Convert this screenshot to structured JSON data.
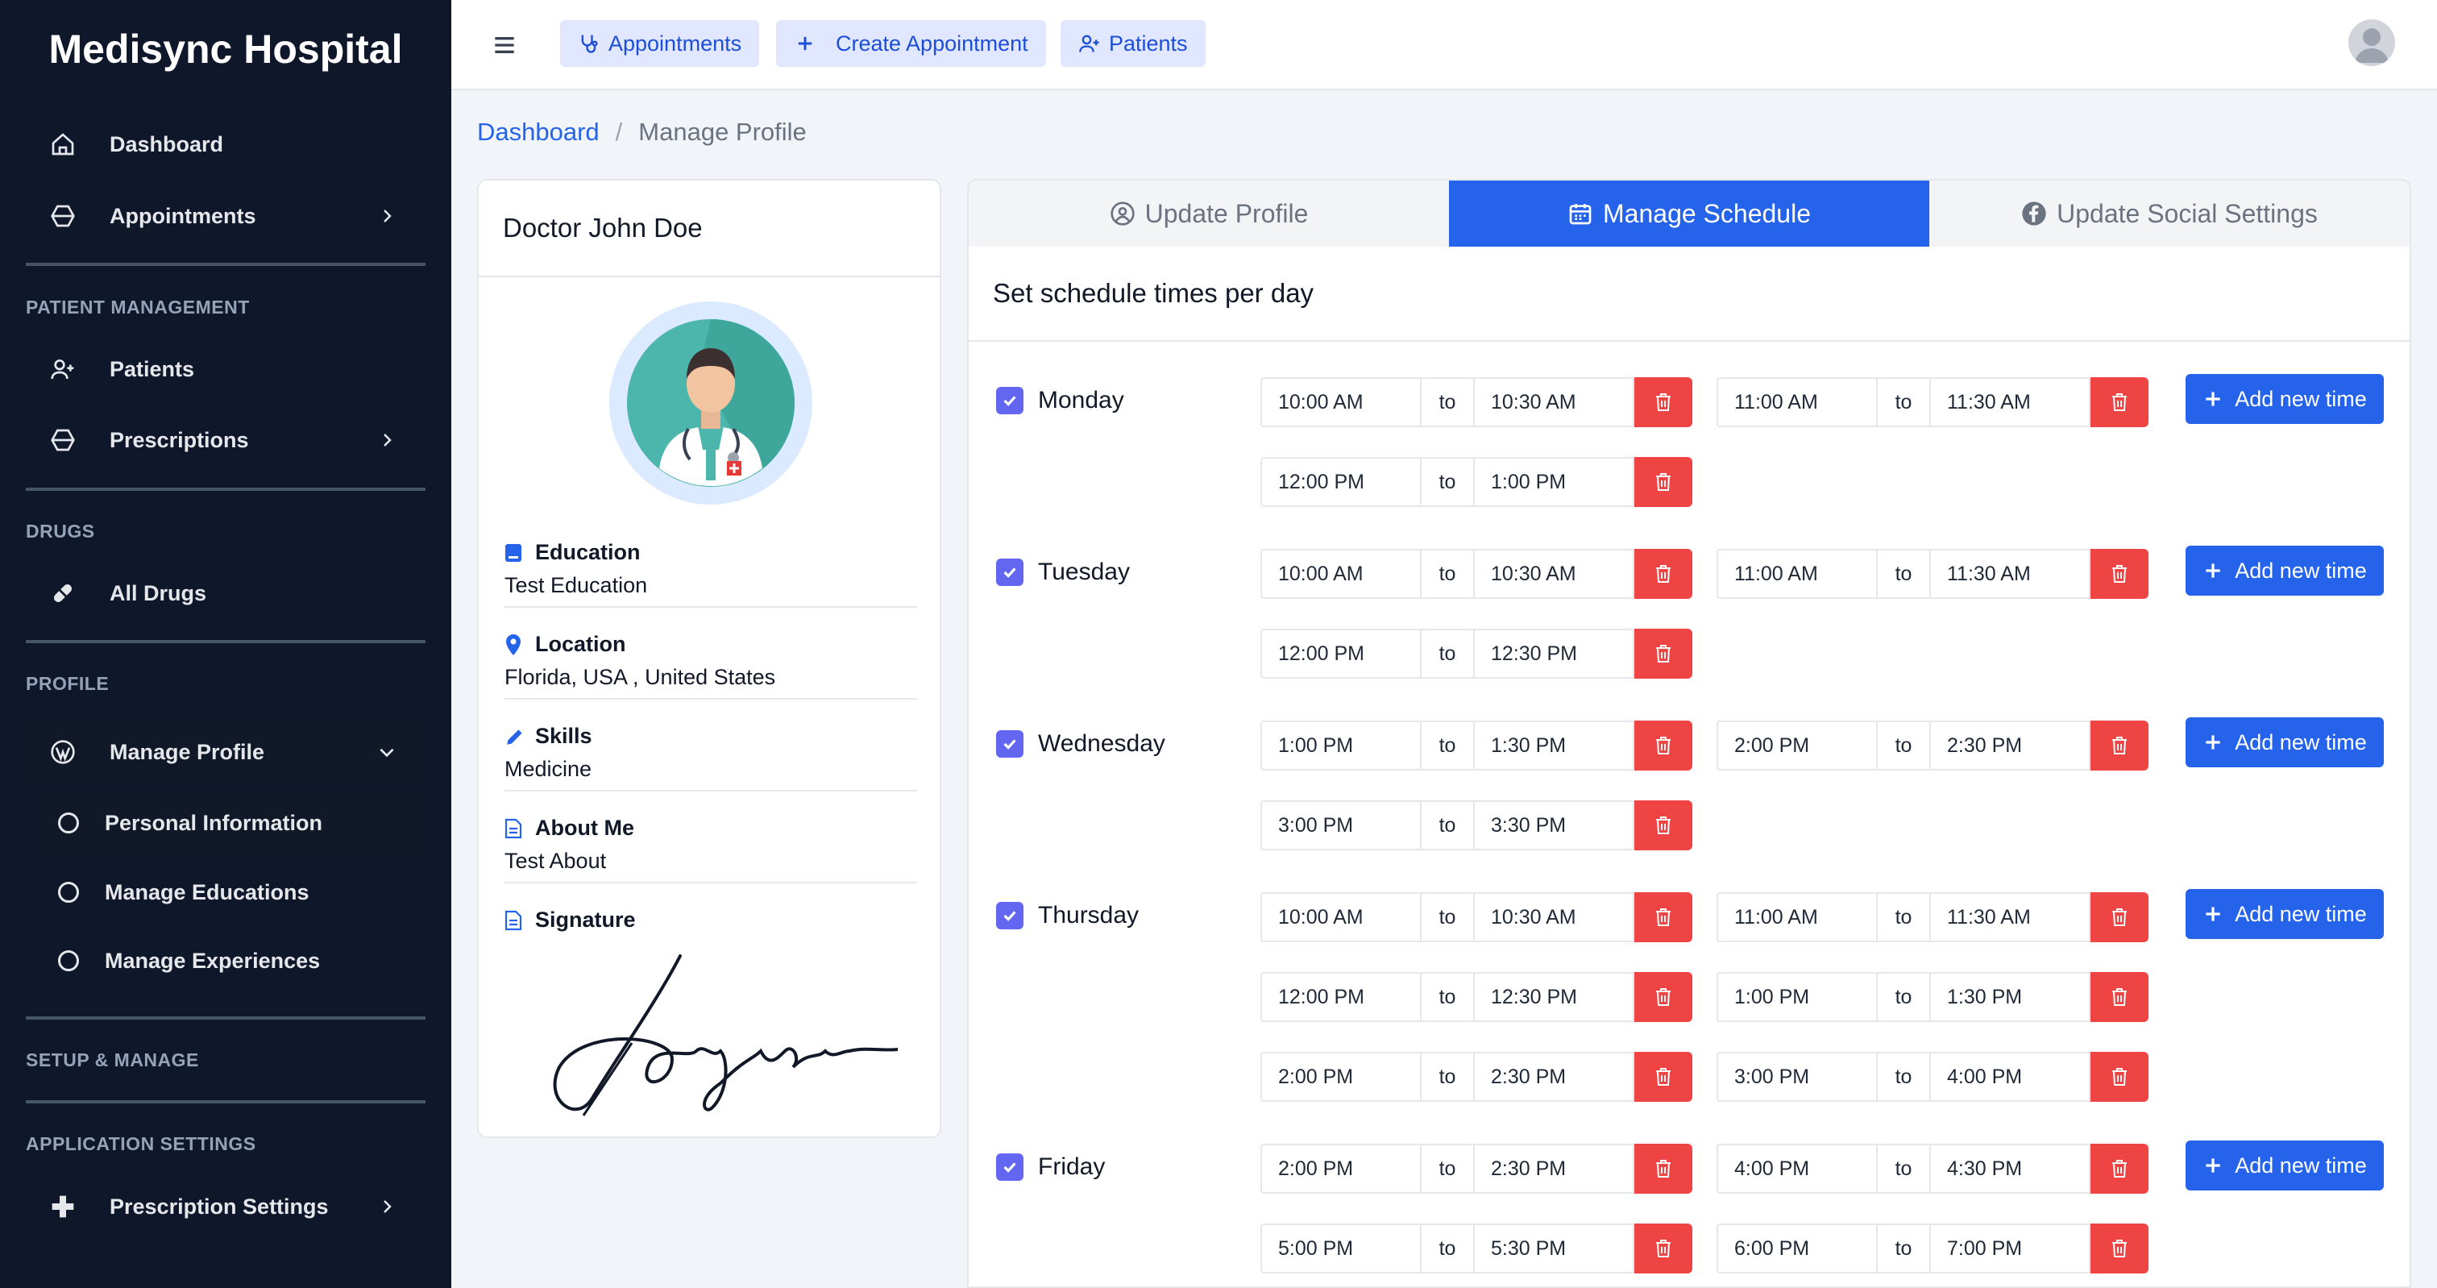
{
  "brand": "Medisync Hospital",
  "sidebar": {
    "dashboard": "Dashboard",
    "appointments": "Appointments",
    "section_patient": "PATIENT MANAGEMENT",
    "patients": "Patients",
    "prescriptions": "Prescriptions",
    "section_drugs": "DRUGS",
    "all_drugs": "All Drugs",
    "section_profile": "PROFILE",
    "manage_profile": "Manage Profile",
    "personal_information": "Personal Information",
    "manage_educations": "Manage Educations",
    "manage_experiences": "Manage Experiences",
    "section_setup": "SETUP & MANAGE",
    "section_app_settings": "APPLICATION SETTINGS",
    "prescription_settings": "Prescription Settings"
  },
  "topbar": {
    "appointments": "Appointments",
    "create_appointment": "Create Appointment",
    "patients": "Patients"
  },
  "breadcrumb": {
    "link": "Dashboard",
    "separator": "/",
    "current": "Manage Profile"
  },
  "profile": {
    "name": "Doctor John Doe",
    "education_label": "Education",
    "education_value": "Test Education",
    "location_label": "Location",
    "location_value": "Florida, USA , United States",
    "skills_label": "Skills",
    "skills_value": "Medicine",
    "about_label": "About Me",
    "about_value": "Test About",
    "signature_label": "Signature"
  },
  "tabs": {
    "update_profile": "Update Profile",
    "manage_schedule": "Manage Schedule",
    "update_social": "Update Social Settings"
  },
  "schedule": {
    "heading": "Set schedule times per day",
    "to_label": "to",
    "add_label": "Add new time",
    "days": [
      {
        "name": "Monday",
        "slots": [
          [
            "10:00 AM",
            "10:30 AM"
          ],
          [
            "11:00 AM",
            "11:30 AM"
          ],
          [
            "12:00 PM",
            "1:00 PM"
          ]
        ]
      },
      {
        "name": "Tuesday",
        "slots": [
          [
            "10:00 AM",
            "10:30 AM"
          ],
          [
            "11:00 AM",
            "11:30 AM"
          ],
          [
            "12:00 PM",
            "12:30 PM"
          ]
        ]
      },
      {
        "name": "Wednesday",
        "slots": [
          [
            "1:00 PM",
            "1:30 PM"
          ],
          [
            "2:00 PM",
            "2:30 PM"
          ],
          [
            "3:00 PM",
            "3:30 PM"
          ]
        ]
      },
      {
        "name": "Thursday",
        "slots": [
          [
            "10:00 AM",
            "10:30 AM"
          ],
          [
            "11:00 AM",
            "11:30 AM"
          ],
          [
            "12:00 PM",
            "12:30 PM"
          ],
          [
            "1:00 PM",
            "1:30 PM"
          ],
          [
            "2:00 PM",
            "2:30 PM"
          ],
          [
            "3:00 PM",
            "4:00 PM"
          ]
        ]
      },
      {
        "name": "Friday",
        "slots": [
          [
            "2:00 PM",
            "2:30 PM"
          ],
          [
            "4:00 PM",
            "4:30 PM"
          ],
          [
            "5:00 PM",
            "5:30 PM"
          ],
          [
            "6:00 PM",
            "7:00 PM"
          ]
        ]
      }
    ]
  },
  "colors": {
    "sidebar_bg": "#0f172a",
    "accent": "#2563eb",
    "delete": "#ef4444",
    "checkbox": "#6366f1"
  }
}
